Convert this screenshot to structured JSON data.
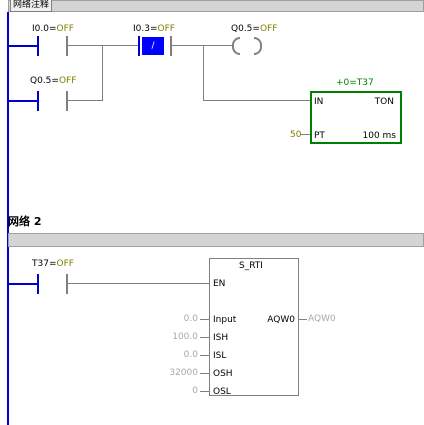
{
  "network1": {
    "comment_label": "网络注释",
    "contacts": {
      "i00": "I0.0=OFF",
      "i03": "I0.3=OFF",
      "q05_branch": "Q0.5=OFF"
    },
    "nc_symbol": "/",
    "coil_label": "Q0.5=OFF",
    "timer": {
      "header": "+0=T37",
      "in": "IN",
      "type": "TON",
      "pt_value": "50",
      "pt": "PT",
      "resolution": "100 ms"
    }
  },
  "network2": {
    "title": "网络 2",
    "contact": "T37=OFF",
    "box": {
      "name": "S_RTI",
      "en": "EN",
      "inputs": [
        {
          "value": "0.0",
          "pin": "Input"
        },
        {
          "value": "100.0",
          "pin": "ISH"
        },
        {
          "value": "0.0",
          "pin": "ISL"
        },
        {
          "value": "32000",
          "pin": "OSH"
        },
        {
          "value": "0",
          "pin": "OSL"
        }
      ],
      "output_pin": "AQW0",
      "output_value": "AQW0"
    }
  },
  "colors": {
    "rail": "#0000cc",
    "wire": "#808080",
    "timer_border": "#008000",
    "nc_fill": "#0000ff",
    "status_text": "#808000"
  }
}
